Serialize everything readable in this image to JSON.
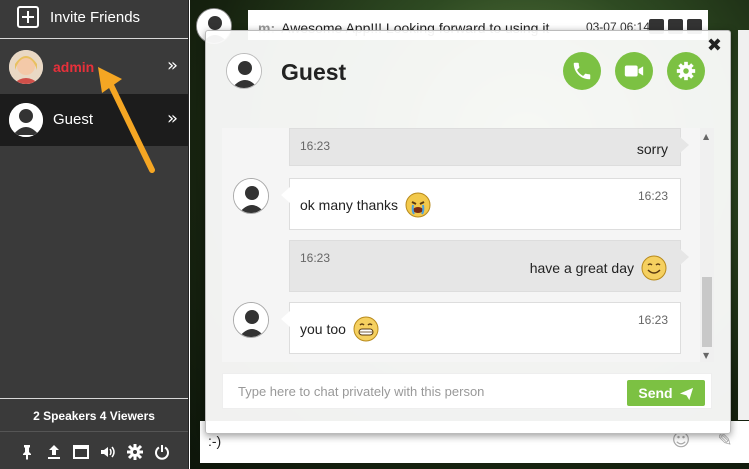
{
  "sidebar": {
    "invite_label": "Invite Friends",
    "users": [
      {
        "name": "admin",
        "action_icon": "double-chevron-right-icon"
      },
      {
        "name": "Guest",
        "action_icon": "double-chevron-right-icon"
      }
    ],
    "stats": "2 Speakers 4 Viewers",
    "tools": [
      "pin-icon",
      "upload-icon",
      "window-icon",
      "volume-icon",
      "gear-icon",
      "power-icon"
    ]
  },
  "background_chat": {
    "message": {
      "user": "m:",
      "text": "Awesome App!!! Looking forward to using it",
      "time": "03-07 06:14"
    },
    "input_value": ":-)"
  },
  "private_chat": {
    "title": "Guest",
    "close_label": "✖",
    "buttons": [
      "phone-icon",
      "video-icon",
      "gear-icon"
    ],
    "messages": [
      {
        "from": "me",
        "time": "16:23",
        "text": "sorry",
        "emoji": null
      },
      {
        "from": "guest",
        "time": "16:23",
        "text": "ok many thanks",
        "emoji": "crying-emoji"
      },
      {
        "from": "me",
        "time": "16:23",
        "text": "have a great day",
        "emoji": "smile-emoji"
      },
      {
        "from": "guest",
        "time": "16:23",
        "text": "you too",
        "emoji": "grin-emoji"
      }
    ],
    "input_placeholder": "Type here to chat privately with this person",
    "send_label": "Send"
  },
  "colors": {
    "accent": "#7cc143",
    "sidebar_bg": "#3a3a3a",
    "admin_name": "#e8303a",
    "annotation_arrow": "#f5a623"
  }
}
